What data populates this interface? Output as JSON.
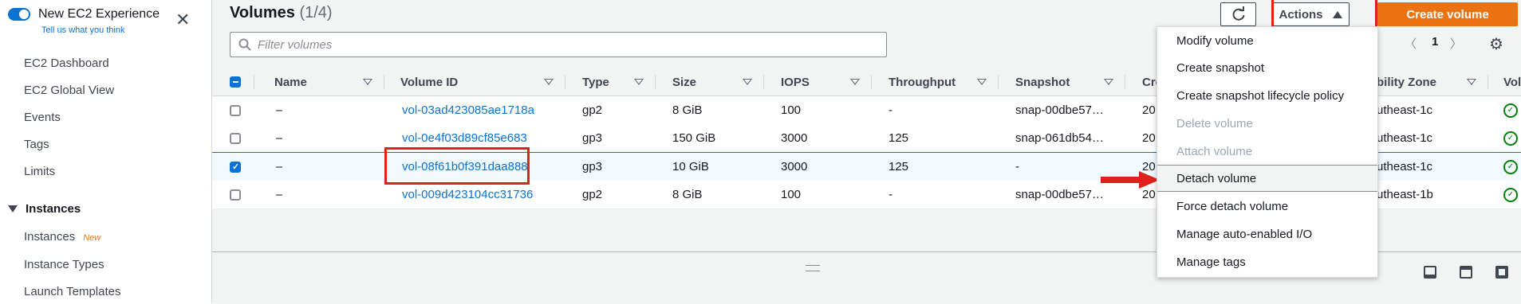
{
  "sidebar": {
    "experience_title": "New EC2 Experience",
    "feedback_link": "Tell us what you think",
    "items": [
      "EC2 Dashboard",
      "EC2 Global View",
      "Events",
      "Tags",
      "Limits"
    ],
    "section_title": "Instances",
    "section_items": [
      {
        "label": "Instances",
        "badge": "New"
      },
      {
        "label": "Instance Types",
        "badge": ""
      },
      {
        "label": "Launch Templates",
        "badge": ""
      }
    ]
  },
  "header": {
    "title": "Volumes",
    "count": "(1/4)",
    "actions_label": "Actions",
    "create_label": "Create volume"
  },
  "search": {
    "placeholder": "Filter volumes"
  },
  "pagination": {
    "page": "1"
  },
  "table": {
    "columns": [
      "Name",
      "Volume ID",
      "Type",
      "Size",
      "IOPS",
      "Throughput",
      "Snapshot",
      "Cre",
      "bility Zone",
      "Vol"
    ],
    "rows": [
      {
        "selected": false,
        "name": "–",
        "volume_id": "vol-03ad423085ae1718a",
        "type": "gp2",
        "size": "8 GiB",
        "iops": "100",
        "throughput": "-",
        "snapshot": "snap-00dbe57…",
        "created": "20",
        "zone": "utheast-1c"
      },
      {
        "selected": false,
        "name": "–",
        "volume_id": "vol-0e4f03d89cf85e683",
        "type": "gp3",
        "size": "150 GiB",
        "iops": "3000",
        "throughput": "125",
        "snapshot": "snap-061db54…",
        "created": "20",
        "zone": "utheast-1c"
      },
      {
        "selected": true,
        "name": "–",
        "volume_id": "vol-08f61b0f391daa888",
        "type": "gp3",
        "size": "10 GiB",
        "iops": "3000",
        "throughput": "125",
        "snapshot": "-",
        "created": "20",
        "zone": "utheast-1c"
      },
      {
        "selected": false,
        "name": "–",
        "volume_id": "vol-009d423104cc31736",
        "type": "gp2",
        "size": "8 GiB",
        "iops": "100",
        "throughput": "-",
        "snapshot": "snap-00dbe57…",
        "created": "20",
        "zone": "utheast-1b"
      }
    ]
  },
  "actions_menu": {
    "items": [
      {
        "label": "Modify volume",
        "disabled": false
      },
      {
        "label": "Create snapshot",
        "disabled": false
      },
      {
        "label": "Create snapshot lifecycle policy",
        "disabled": false
      },
      {
        "label": "Delete volume",
        "disabled": true
      },
      {
        "label": "Attach volume",
        "disabled": true
      },
      {
        "label": "Detach volume",
        "disabled": false,
        "highlighted": true
      },
      {
        "label": "Force detach volume",
        "disabled": false
      },
      {
        "label": "Manage auto-enabled I/O",
        "disabled": false
      },
      {
        "label": "Manage tags",
        "disabled": false
      }
    ]
  },
  "colors": {
    "accent": "#0972d3",
    "primary_button": "#ec7211",
    "annotation": "#e0201b",
    "status_ok": "#037f0c"
  },
  "icons": [
    "refresh-icon",
    "caret-up-icon",
    "search-icon",
    "chevron-left-icon",
    "chevron-right-icon",
    "settings-gear-icon",
    "close-icon",
    "status-ok-icon",
    "red-arrow-icon"
  ]
}
